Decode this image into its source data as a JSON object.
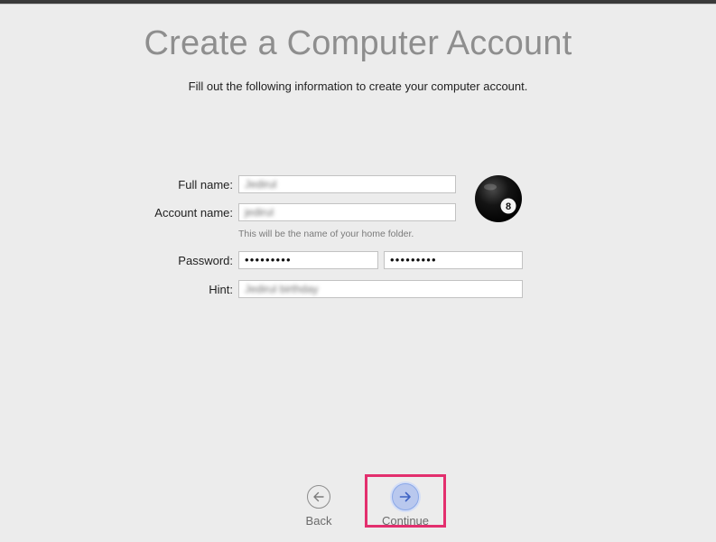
{
  "header": {
    "title": "Create a Computer Account",
    "subtitle": "Fill out the following information to create your computer account."
  },
  "form": {
    "full_name": {
      "label": "Full name:",
      "value": "Jedirul"
    },
    "account_name": {
      "label": "Account name:",
      "value": "jedirul",
      "helper": "This will be the name of your home folder."
    },
    "password": {
      "label": "Password:",
      "value": "•••••••••",
      "verify_value": "•••••••••"
    },
    "hint": {
      "label": "Hint:",
      "value": "Jedirul birthday"
    }
  },
  "avatar": {
    "icon": "eight-ball-icon",
    "glyph": "8"
  },
  "nav": {
    "back_label": "Back",
    "continue_label": "Continue"
  },
  "colors": {
    "highlight": "#e32f6e",
    "continue_accent": "#8aa8e8"
  }
}
